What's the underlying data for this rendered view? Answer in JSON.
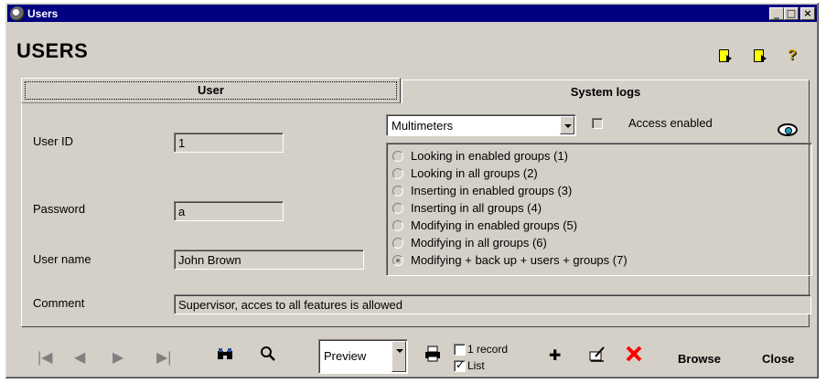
{
  "window": {
    "title": "Users"
  },
  "page_title": "USERS",
  "tabs": [
    {
      "label": "User"
    },
    {
      "label": "System logs"
    }
  ],
  "form": {
    "user_id_label": "User ID",
    "user_id_value": "1",
    "password_label": "Password",
    "password_value": "a",
    "user_name_label": "User name",
    "user_name_value": "John Brown",
    "comment_label": "Comment",
    "comment_value": "Supervisor, acces to all features is allowed",
    "group_select_value": "Multimeters",
    "access_enabled_label": "Access enabled",
    "access_enabled_checked": false,
    "permissions": [
      {
        "label": "Looking in enabled groups (1)",
        "checked": false
      },
      {
        "label": "Looking in all groups (2)",
        "checked": false
      },
      {
        "label": "Inserting in enabled groups (3)",
        "checked": false
      },
      {
        "label": "Inserting in all groups (4)",
        "checked": false
      },
      {
        "label": "Modifying in enabled groups (5)",
        "checked": false
      },
      {
        "label": "Modifying in all groups (6)",
        "checked": false
      },
      {
        "label": "Modifying + back up + users + groups (7)",
        "checked": true
      }
    ]
  },
  "toolbar": {
    "view_select_value": "Preview",
    "one_record_label": "1 record",
    "one_record_checked": false,
    "list_label": "List",
    "list_checked": true,
    "browse_label": "Browse",
    "close_label": "Close"
  },
  "icons": {
    "accent": "#000080",
    "delete_color": "#ff0000"
  }
}
